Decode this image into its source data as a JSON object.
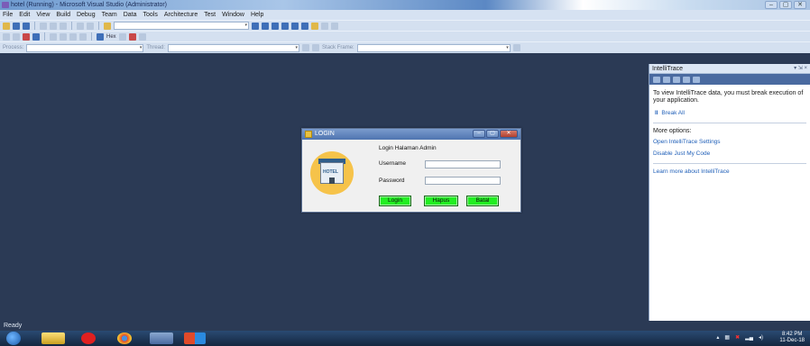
{
  "window": {
    "title": "hotel (Running) - Microsoft Visual Studio (Administrator)",
    "buttons": [
      "–",
      "▢",
      "✕"
    ]
  },
  "menu": [
    "File",
    "Edit",
    "View",
    "Build",
    "Debug",
    "Team",
    "Data",
    "Tools",
    "Architecture",
    "Test",
    "Window",
    "Help"
  ],
  "toolbar": {
    "hex_label": "Hex",
    "process_label": "Process:",
    "thread_label": "Thread:",
    "stack_frame_label": "Stack Frame:"
  },
  "intellitrace": {
    "title": "IntelliTrace",
    "controls": "▾ ⇲ ×",
    "message": "To view IntelliTrace data, you must break execution of your application.",
    "break_all": "Break All",
    "more_options": "More options:",
    "open_settings": "Open IntelliTrace Settings",
    "disable_jmc": "Disable Just My Code",
    "learn_more": "Learn more about IntelliTrace"
  },
  "login": {
    "title": "LOGIN",
    "heading": "Login Halaman Admin",
    "username_label": "Username",
    "password_label": "Password",
    "username_value": "",
    "password_value": "",
    "logo_text": "HOTEL",
    "buttons": {
      "login": "Login",
      "hapus": "Hapus",
      "batal": "Batal"
    },
    "button_color": "#22ee22"
  },
  "status": {
    "text": "Ready"
  },
  "taskbar": {
    "time": "8:42 PM",
    "date": "11-Dec-18"
  },
  "colors": {
    "background": "#2b3a55",
    "chrome": "#d6e2f2",
    "accent": "#1f5fb8"
  }
}
